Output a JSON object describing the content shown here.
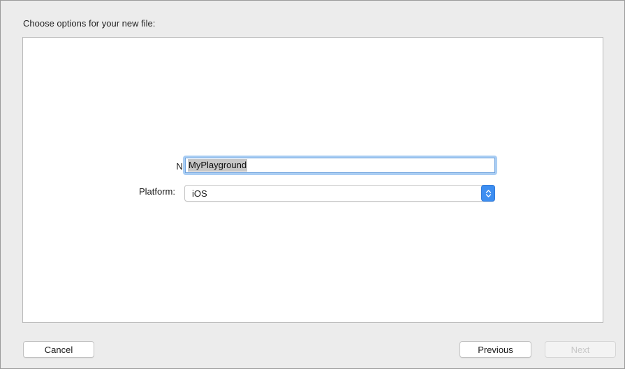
{
  "dialog": {
    "heading": "Choose options for your new file:"
  },
  "form": {
    "name_label": "Name",
    "name_value": "MyPlayground",
    "platform_label": "Platform:",
    "platform_value": "iOS"
  },
  "buttons": {
    "cancel_label": "Cancel",
    "previous_label": "Previous",
    "next_label": "Next"
  },
  "icons": {
    "stepper": "chevron-up-down-icon"
  },
  "colors": {
    "accent": "#3d8ef1",
    "focus_ring": "#a9cdf3",
    "selection": "#c7c7c7"
  }
}
